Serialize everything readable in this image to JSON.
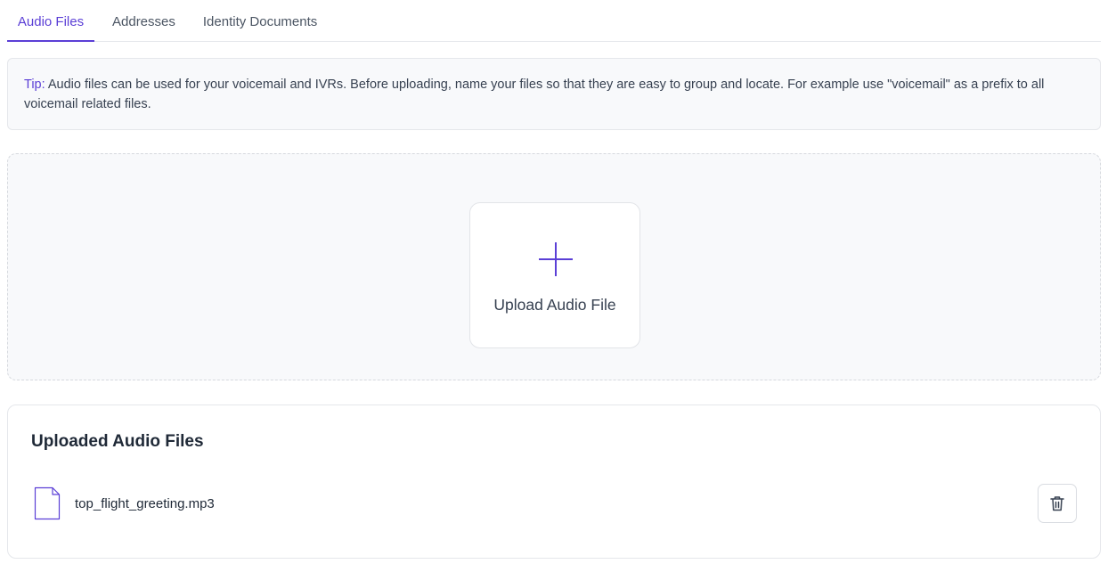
{
  "tabs": [
    {
      "label": "Audio Files",
      "active": true
    },
    {
      "label": "Addresses",
      "active": false
    },
    {
      "label": "Identity Documents",
      "active": false
    }
  ],
  "tip": {
    "label": "Tip:",
    "text": " Audio files can be used for your voicemail and IVRs. Before uploading, name your files so that they are easy to group and locate. For example use \"voicemail\" as a prefix to all voicemail related files."
  },
  "upload": {
    "label": "Upload Audio File",
    "icon": "plus-icon"
  },
  "uploaded": {
    "title": "Uploaded Audio Files",
    "files": [
      {
        "name": "top_flight_greeting.mp3",
        "icon": "file-icon",
        "action_icon": "trash-icon"
      }
    ]
  },
  "colors": {
    "accent": "#5b3fd6",
    "panel_bg": "#f8f9fb",
    "border": "#e5e7eb"
  }
}
